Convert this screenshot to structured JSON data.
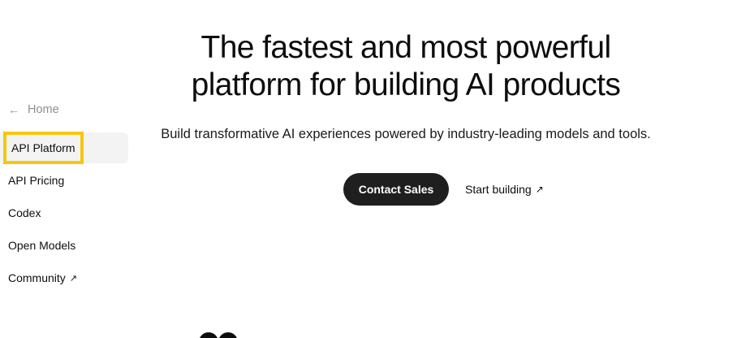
{
  "sidebar": {
    "back_label": "Home",
    "items": [
      {
        "label": "API Platform",
        "external": false
      },
      {
        "label": "API Pricing",
        "external": false
      },
      {
        "label": "Codex",
        "external": false
      },
      {
        "label": "Open Models",
        "external": false
      },
      {
        "label": "Community",
        "external": true
      }
    ],
    "highlight_color": "#f7c60f"
  },
  "hero": {
    "title_line1": "The fastest and most powerful",
    "title_line2": "platform for building AI products",
    "subtitle": "Build transformative AI experiences powered by industry-leading models and tools.",
    "primary_cta": "Contact Sales",
    "secondary_cta": "Start building"
  },
  "icons": {
    "back": "arrow-left-icon",
    "external": "arrow-up-right-icon"
  }
}
